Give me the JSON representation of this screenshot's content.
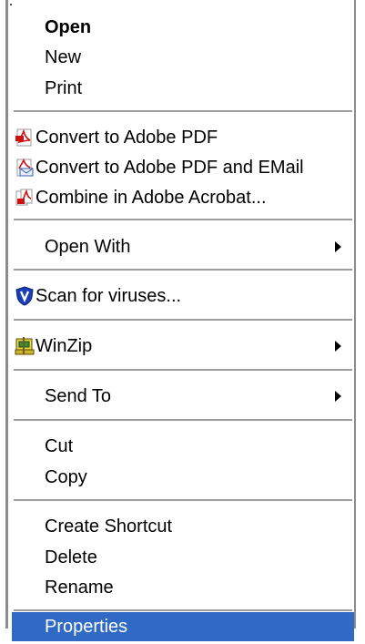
{
  "menu": {
    "items": [
      {
        "label": "Open",
        "bold": true
      },
      {
        "label": "New"
      },
      {
        "label": "Print"
      },
      {
        "label": "Convert to Adobe PDF",
        "icon": "adobe-pdf-icon"
      },
      {
        "label": "Convert to Adobe PDF and EMail",
        "icon": "adobe-pdf-email-icon"
      },
      {
        "label": "Combine in Adobe Acrobat...",
        "icon": "adobe-acrobat-combine-icon"
      },
      {
        "label": "Open With",
        "submenu": true
      },
      {
        "label": "Scan for viruses...",
        "icon": "antivirus-shield-icon"
      },
      {
        "label": "WinZip",
        "icon": "winzip-icon",
        "submenu": true
      },
      {
        "label": "Send To",
        "submenu": true
      },
      {
        "label": "Cut"
      },
      {
        "label": "Copy"
      },
      {
        "label": "Create Shortcut"
      },
      {
        "label": "Delete"
      },
      {
        "label": "Rename"
      },
      {
        "label": "Properties",
        "selected": true
      }
    ]
  },
  "colors": {
    "selection": "#316ac5",
    "separator": "#9c9c9c",
    "border": "#8c8c8c"
  }
}
